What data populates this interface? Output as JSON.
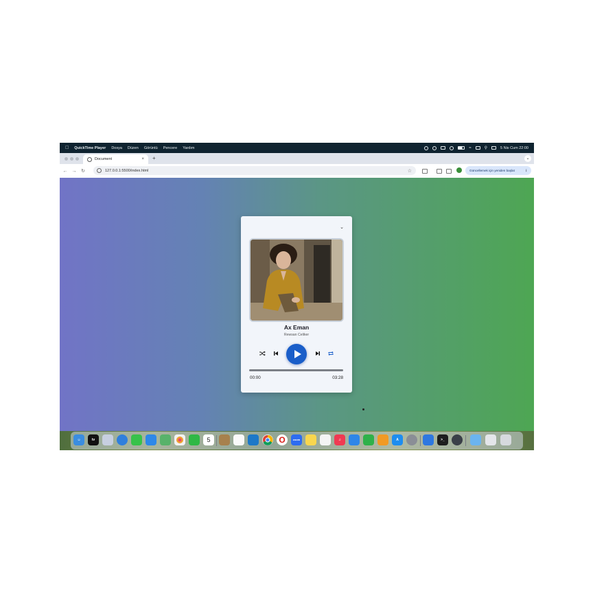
{
  "menubar": {
    "app_name": "QuickTime Player",
    "menus": [
      "Dosya",
      "Düzen",
      "Görüntü",
      "Pencere",
      "Yardım"
    ],
    "clock": "5 Nis Cum  22:00"
  },
  "browser": {
    "tab_title": "Document",
    "new_tab": "+",
    "tab_close": "×",
    "url": "127.0.0.1:5500/index.html",
    "update_label": "Güncellemek için yeniden başlat"
  },
  "player": {
    "title": "Ax Eman",
    "artist": "Rewsan Celiker",
    "current_time": "00:00",
    "duration": "03:28",
    "progress": 0
  },
  "colors": {
    "gradient_left": "#7174c6",
    "gradient_right": "#4ea653",
    "play_button": "#1a5ec9",
    "card": "#f2f5fa"
  },
  "dock": {
    "items": [
      "finder",
      "tv",
      "launchpad",
      "safari",
      "messages",
      "mail",
      "maps",
      "photos",
      "facetime",
      "calendar",
      "notes-brown",
      "reminders",
      "vscode",
      "chrome",
      "opera",
      "zoom",
      "notes",
      "keynote",
      "music",
      "keynote-blue",
      "numbers",
      "pages",
      "app-store",
      "system-settings",
      "preview",
      "terminal",
      "quicktime",
      "folder",
      "trash"
    ],
    "calendar_day": "5",
    "zoom_label": "zoom"
  }
}
